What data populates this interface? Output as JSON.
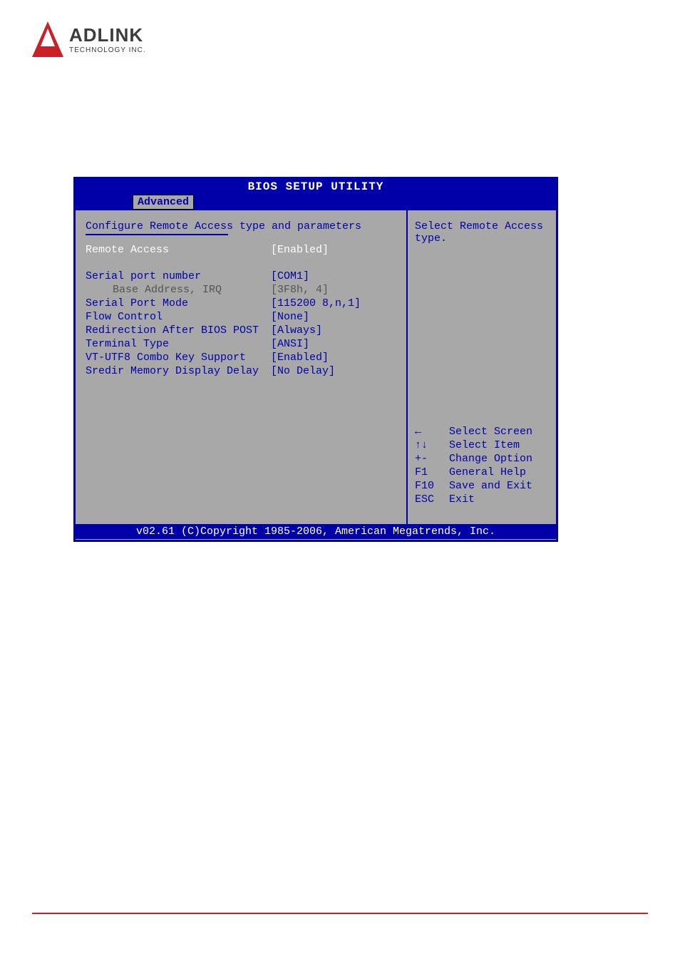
{
  "logo": {
    "main": "ADLINK",
    "sub": "TECHNOLOGY INC."
  },
  "bios": {
    "title": "BIOS SETUP UTILITY",
    "tab": "Advanced",
    "section_header": "Configure Remote Access type and parameters",
    "settings": {
      "remote_access": {
        "label": "Remote Access",
        "value": "[Enabled]"
      },
      "serial_port_number": {
        "label": "Serial port number",
        "value": "[COM1]"
      },
      "base_address": {
        "label": "Base Address, IRQ",
        "value": "[3F8h, 4]"
      },
      "serial_port_mode": {
        "label": "Serial Port Mode",
        "value": "[115200 8,n,1]"
      },
      "flow_control": {
        "label": "Flow Control",
        "value": "[None]"
      },
      "redirection": {
        "label": "Redirection After BIOS POST",
        "value": "[Always]"
      },
      "terminal_type": {
        "label": "Terminal Type",
        "value": "[ANSI]"
      },
      "vt_utf8": {
        "label": "VT-UTF8 Combo Key Support",
        "value": "[Enabled]"
      },
      "sredir": {
        "label": "Sredir Memory Display Delay",
        "value": "[No Delay]"
      }
    },
    "side_help": {
      "line1": "Select Remote Access",
      "line2": "type."
    },
    "nav_help": [
      {
        "key": "←",
        "desc": "Select Screen"
      },
      {
        "key": "↑↓",
        "desc": "Select Item"
      },
      {
        "key": "+-",
        "desc": "Change Option"
      },
      {
        "key": "F1",
        "desc": "General Help"
      },
      {
        "key": "F10",
        "desc": "Save and Exit"
      },
      {
        "key": "ESC",
        "desc": "Exit"
      }
    ],
    "footer": "v02.61 (C)Copyright 1985-2006, American Megatrends, Inc."
  }
}
